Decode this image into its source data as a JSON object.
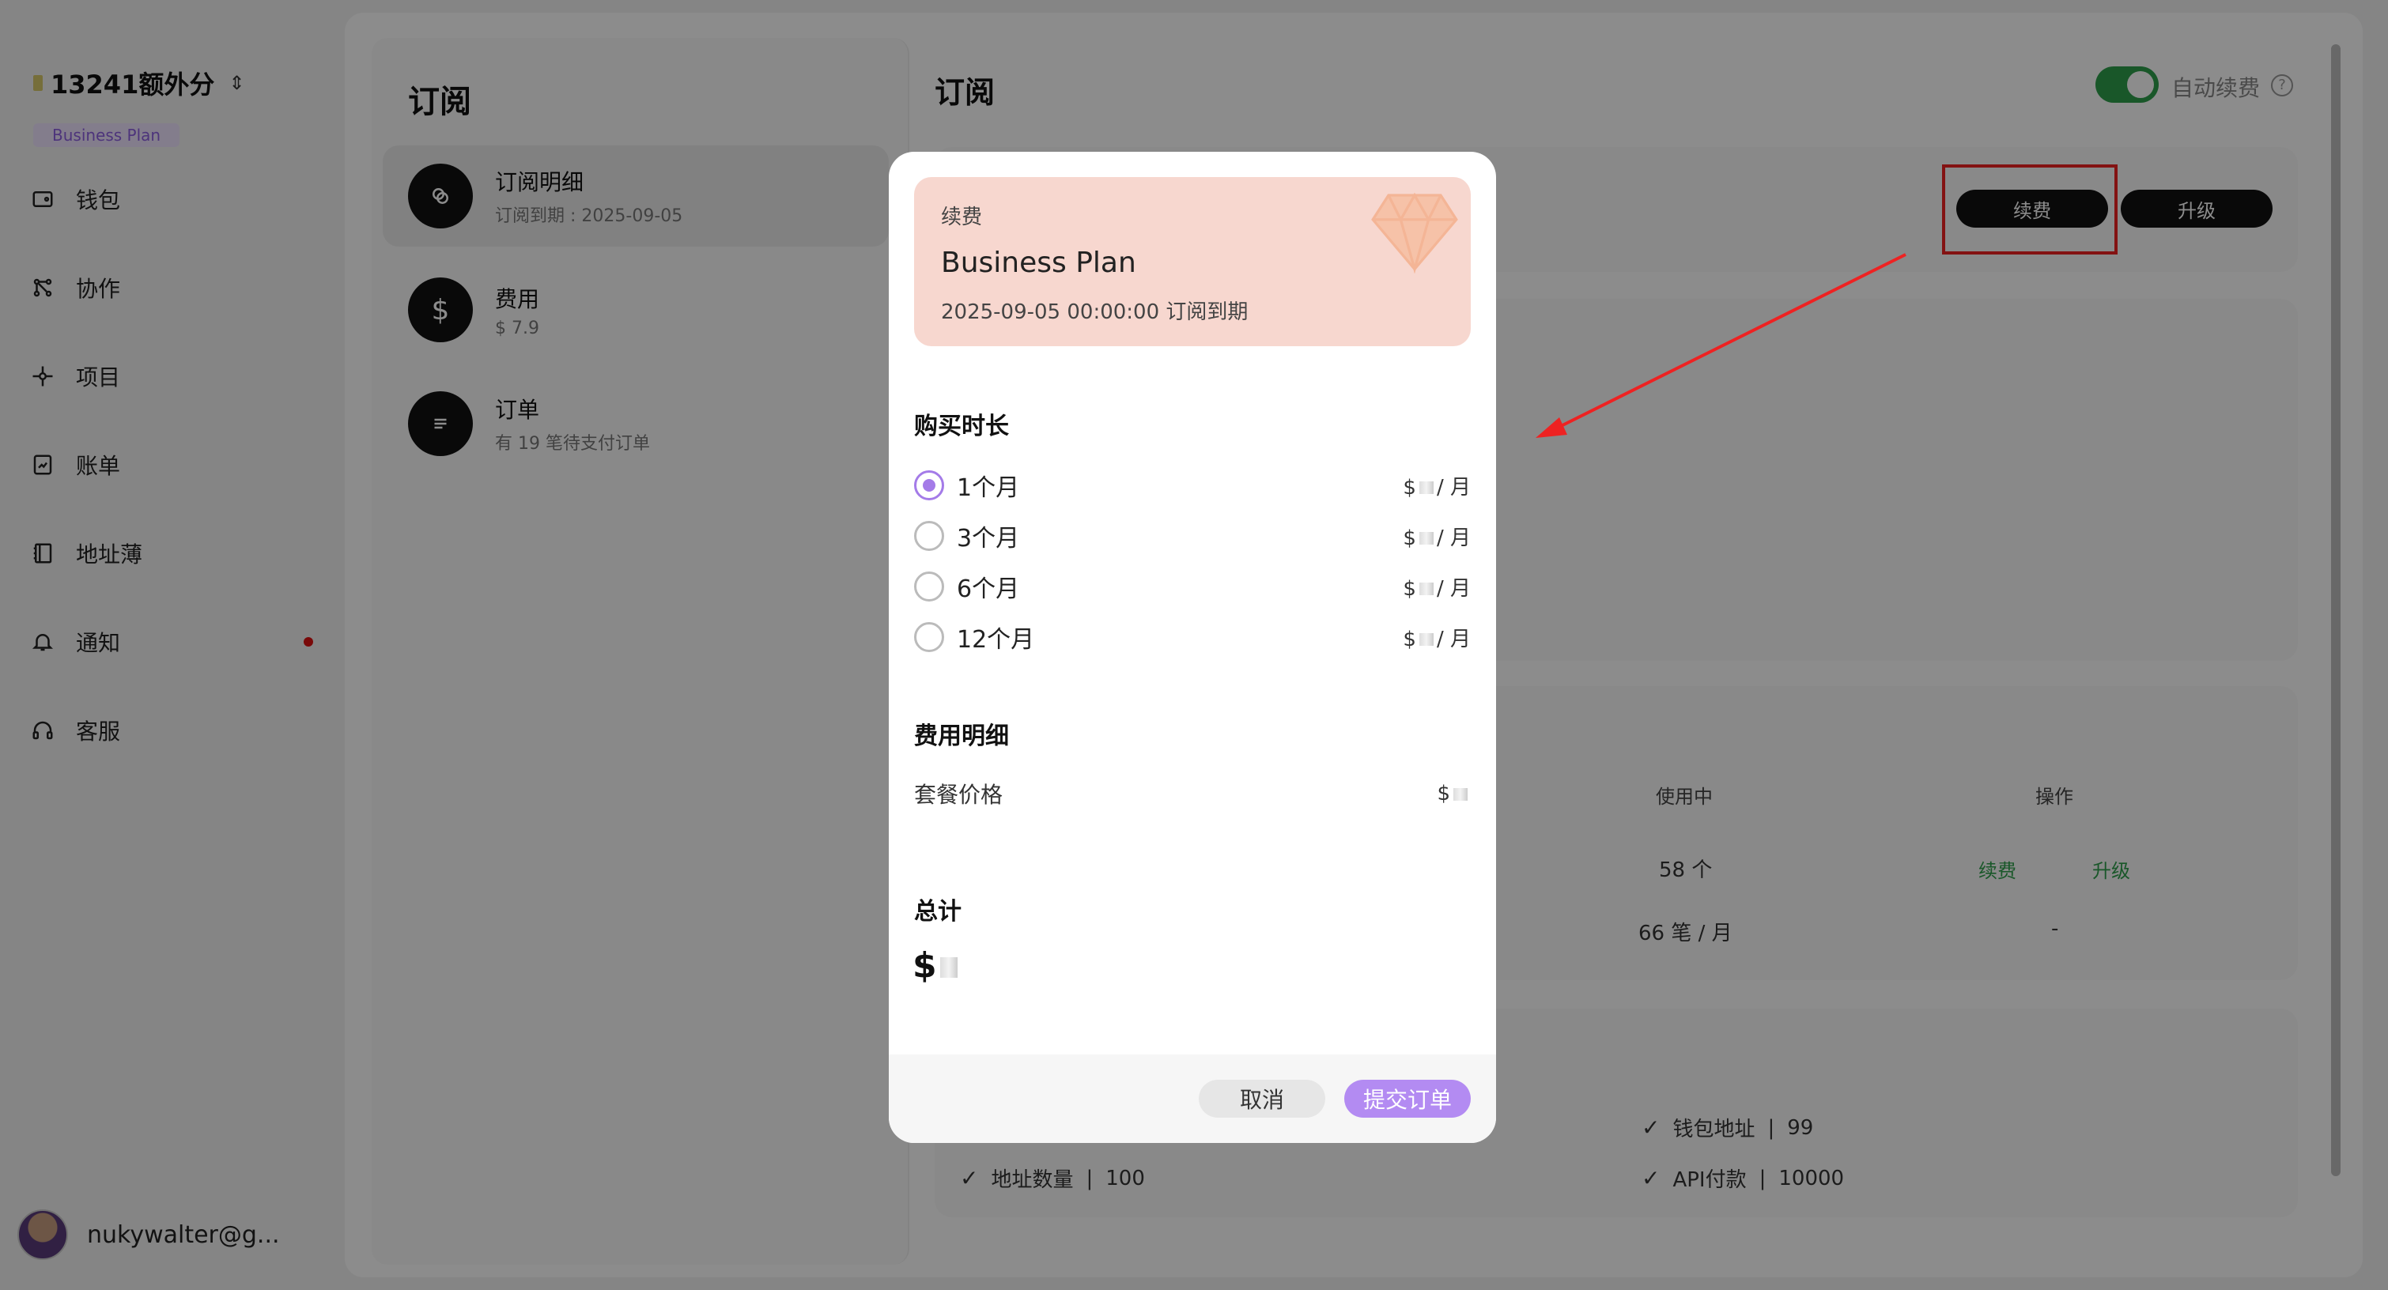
{
  "org": {
    "name": "13241额外分",
    "plan_badge": "Business Plan"
  },
  "nav": {
    "items": [
      {
        "label": "钱包",
        "icon": "wallet-icon"
      },
      {
        "label": "协作",
        "icon": "share-icon"
      },
      {
        "label": "项目",
        "icon": "project-icon"
      },
      {
        "label": "账单",
        "icon": "bill-icon"
      },
      {
        "label": "地址薄",
        "icon": "address-book-icon"
      },
      {
        "label": "通知",
        "icon": "bell-icon"
      },
      {
        "label": "客服",
        "icon": "headset-icon"
      }
    ],
    "user_email": "nukywalter@g..."
  },
  "sub": {
    "title": "订阅",
    "items": [
      {
        "title": "订阅明细",
        "desc": "订阅到期 : 2025-09-05"
      },
      {
        "title": "费用",
        "desc": "$ 7.9"
      },
      {
        "title": "订单",
        "desc": "有 19 笔待支付订单"
      }
    ]
  },
  "content": {
    "title": "订阅",
    "auto_renew_label": "自动续费",
    "buttons": {
      "renew": "续费",
      "upgrade": "升级"
    },
    "table": {
      "col_in_use": "使用中",
      "col_action": "操作",
      "row1": {
        "in_use": "58 个",
        "renew": "续费",
        "upgrade": "升级"
      },
      "row2": {
        "in_use": "66 笔 / 月",
        "action": "-"
      }
    },
    "features": {
      "wallet_label": "钱包地址",
      "wallet_value": "99",
      "address_label": "地址数量",
      "address_value": "100",
      "api_label": "API付款",
      "api_value": "10000"
    }
  },
  "modal": {
    "card_label": "续费",
    "plan": "Business Plan",
    "expiry": "2025-09-05 00:00:00 订阅到期",
    "duration_title": "购买时长",
    "options": [
      {
        "label": "1个月",
        "price_prefix": "$",
        "price_suffix": "/ 月",
        "selected": true
      },
      {
        "label": "3个月",
        "price_prefix": "$",
        "price_suffix": "/ 月",
        "selected": false
      },
      {
        "label": "6个月",
        "price_prefix": "$",
        "price_suffix": "/ 月",
        "selected": false
      },
      {
        "label": "12个月",
        "price_prefix": "$",
        "price_suffix": "/ 月",
        "selected": false
      }
    ],
    "fee_title": "费用明细",
    "package_price_label": "套餐价格",
    "package_price_prefix": "$",
    "total_title": "总计",
    "total_prefix": "$",
    "cancel": "取消",
    "submit": "提交订单"
  },
  "colors": {
    "accent": "#b38bf2",
    "green": "#2e9e4c",
    "annotation": "#e22222"
  }
}
